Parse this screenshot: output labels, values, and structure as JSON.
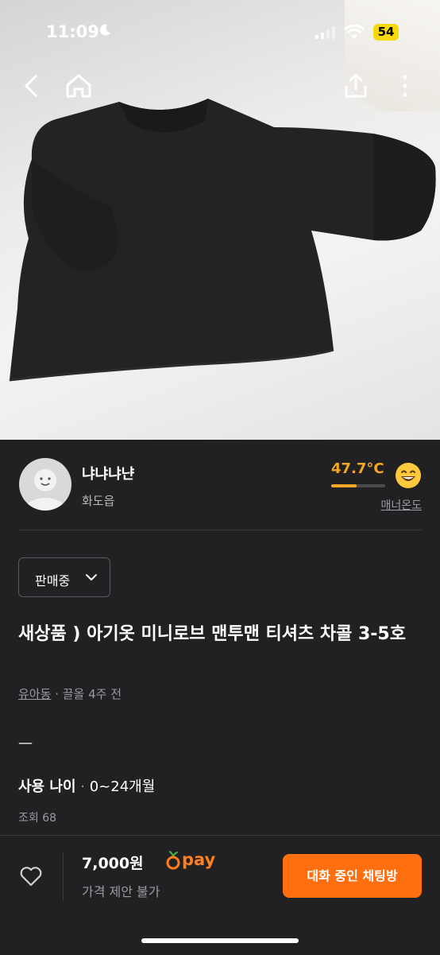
{
  "status_bar": {
    "time": "11:09",
    "battery": "54"
  },
  "nav": {
    "back_icon": "chevron-left-icon",
    "home_icon": "home-icon",
    "share_icon": "share-icon",
    "more_icon": "more-vertical-icon"
  },
  "seller": {
    "name": "냐냐냐냔",
    "location": "화도읍",
    "temperature": "47.7°C",
    "temperature_level": 0.477,
    "manner_label": "매너온도"
  },
  "product": {
    "status_select": "판매중",
    "title": "새상품 ) 아기옷 미니로브 맨투맨 티셔츠 차콜 3-5호",
    "location": "유아동",
    "bumped": "끌올 4주 전",
    "description": "—",
    "age_label": "사용 나이",
    "age_value": "0~24개월",
    "views": "조회 68"
  },
  "bottom_bar": {
    "price": "7,000원",
    "pay_label": "pay",
    "negotiation": "가격 제안 불가",
    "chat_button": "대화 중인 채팅방"
  },
  "colors": {
    "accent": "#ff6f0f",
    "temperature": "#f5a623",
    "background": "#212123"
  }
}
